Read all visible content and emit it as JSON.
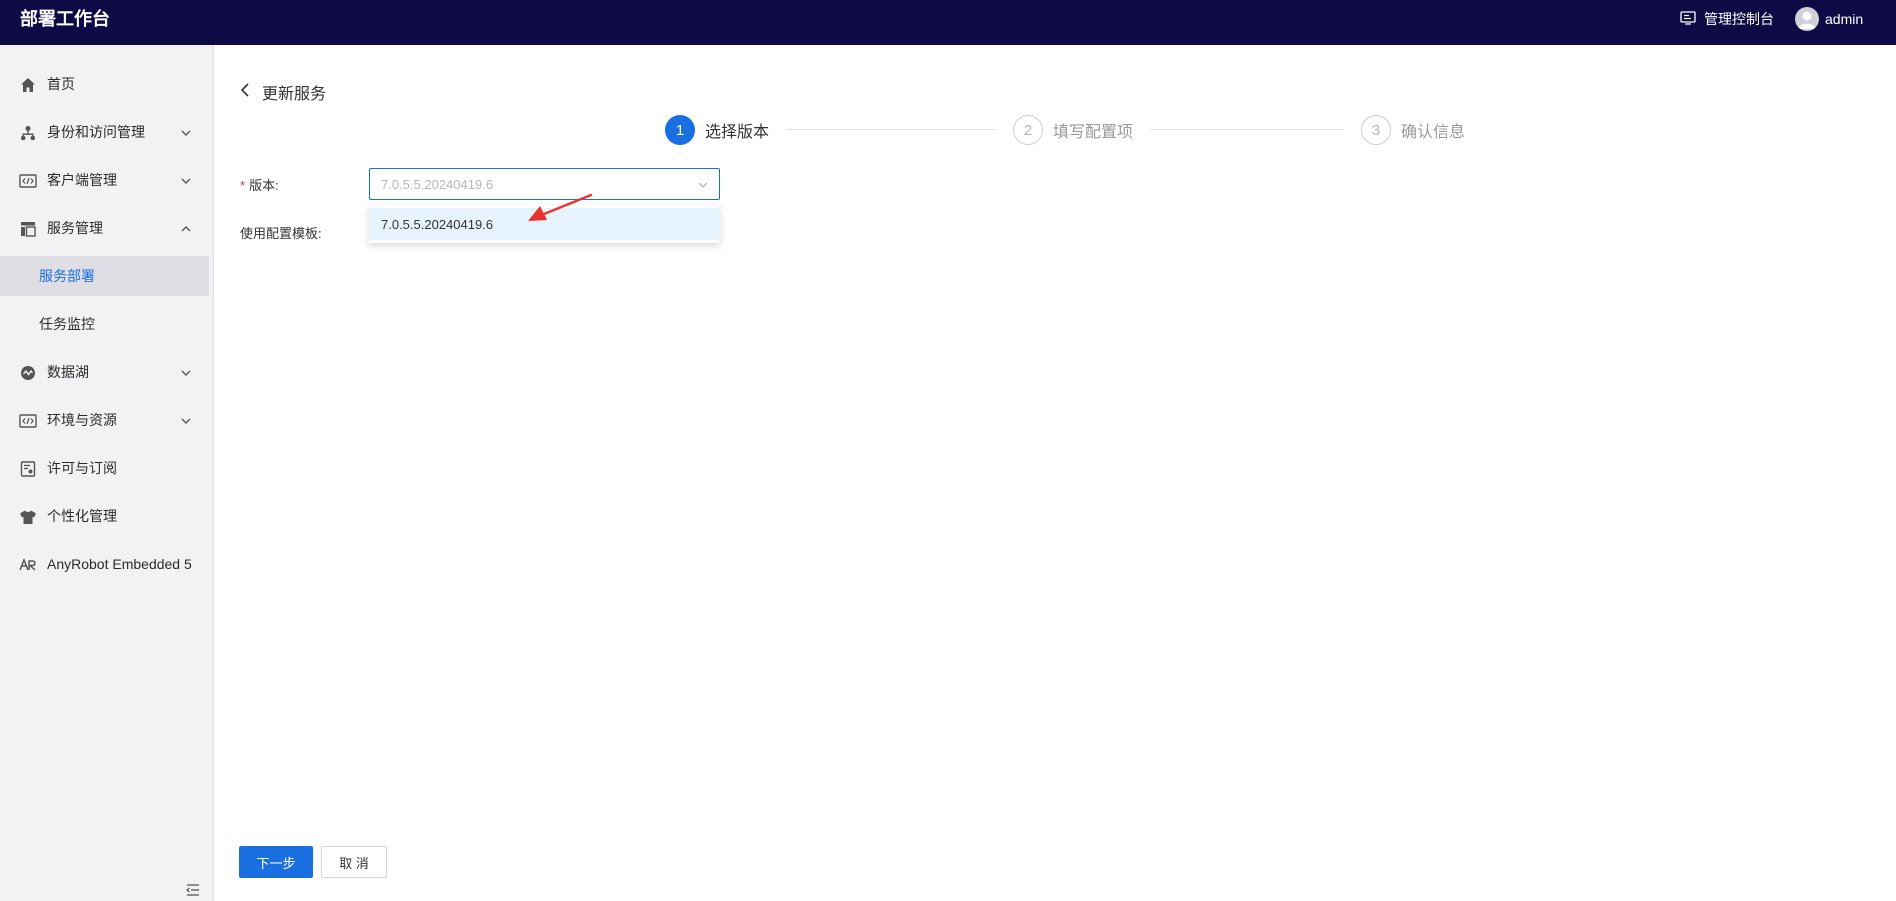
{
  "header": {
    "app_title": "部署工作台",
    "console_label": "管理控制台",
    "user_name": "admin",
    "background_color": "#0d0a46"
  },
  "sidebar": {
    "items": [
      {
        "label": "首页",
        "icon": "home-icon"
      },
      {
        "label": "身份和访问管理",
        "icon": "org-tree-icon",
        "expandable": true,
        "expanded": false
      },
      {
        "label": "客户端管理",
        "icon": "code-window-icon",
        "expandable": true,
        "expanded": false
      },
      {
        "label": "服务管理",
        "icon": "layout-icon",
        "expandable": true,
        "expanded": true
      },
      {
        "label": "服务部署",
        "sub": true,
        "active": true
      },
      {
        "label": "任务监控",
        "sub": true
      },
      {
        "label": "数据湖",
        "icon": "data-lake-icon",
        "expandable": true,
        "expanded": false
      },
      {
        "label": "环境与资源",
        "icon": "code-window-icon",
        "expandable": true,
        "expanded": false
      },
      {
        "label": "许可与订阅",
        "icon": "license-icon"
      },
      {
        "label": "个性化管理",
        "icon": "shirt-icon"
      },
      {
        "label": "AnyRobot Embedded 5",
        "icon": "anyrobot-logo-icon"
      }
    ]
  },
  "page": {
    "back_title": "更新服务"
  },
  "steps": [
    {
      "number": "1",
      "label": "选择版本",
      "status": "current"
    },
    {
      "number": "2",
      "label": "填写配置项",
      "status": "pending"
    },
    {
      "number": "3",
      "label": "确认信息",
      "status": "pending"
    }
  ],
  "form": {
    "version_label": "版本:",
    "version_required_mark": "*",
    "version_placeholder": "7.0.5.5.20240419.6",
    "template_label": "使用配置模板:",
    "dropdown_options": [
      "7.0.5.5.20240419.6"
    ]
  },
  "buttons": {
    "next": "下一步",
    "cancel": "取 消"
  },
  "colors": {
    "accent": "#1a6fe0",
    "annotation_arrow": "#e8342e"
  }
}
